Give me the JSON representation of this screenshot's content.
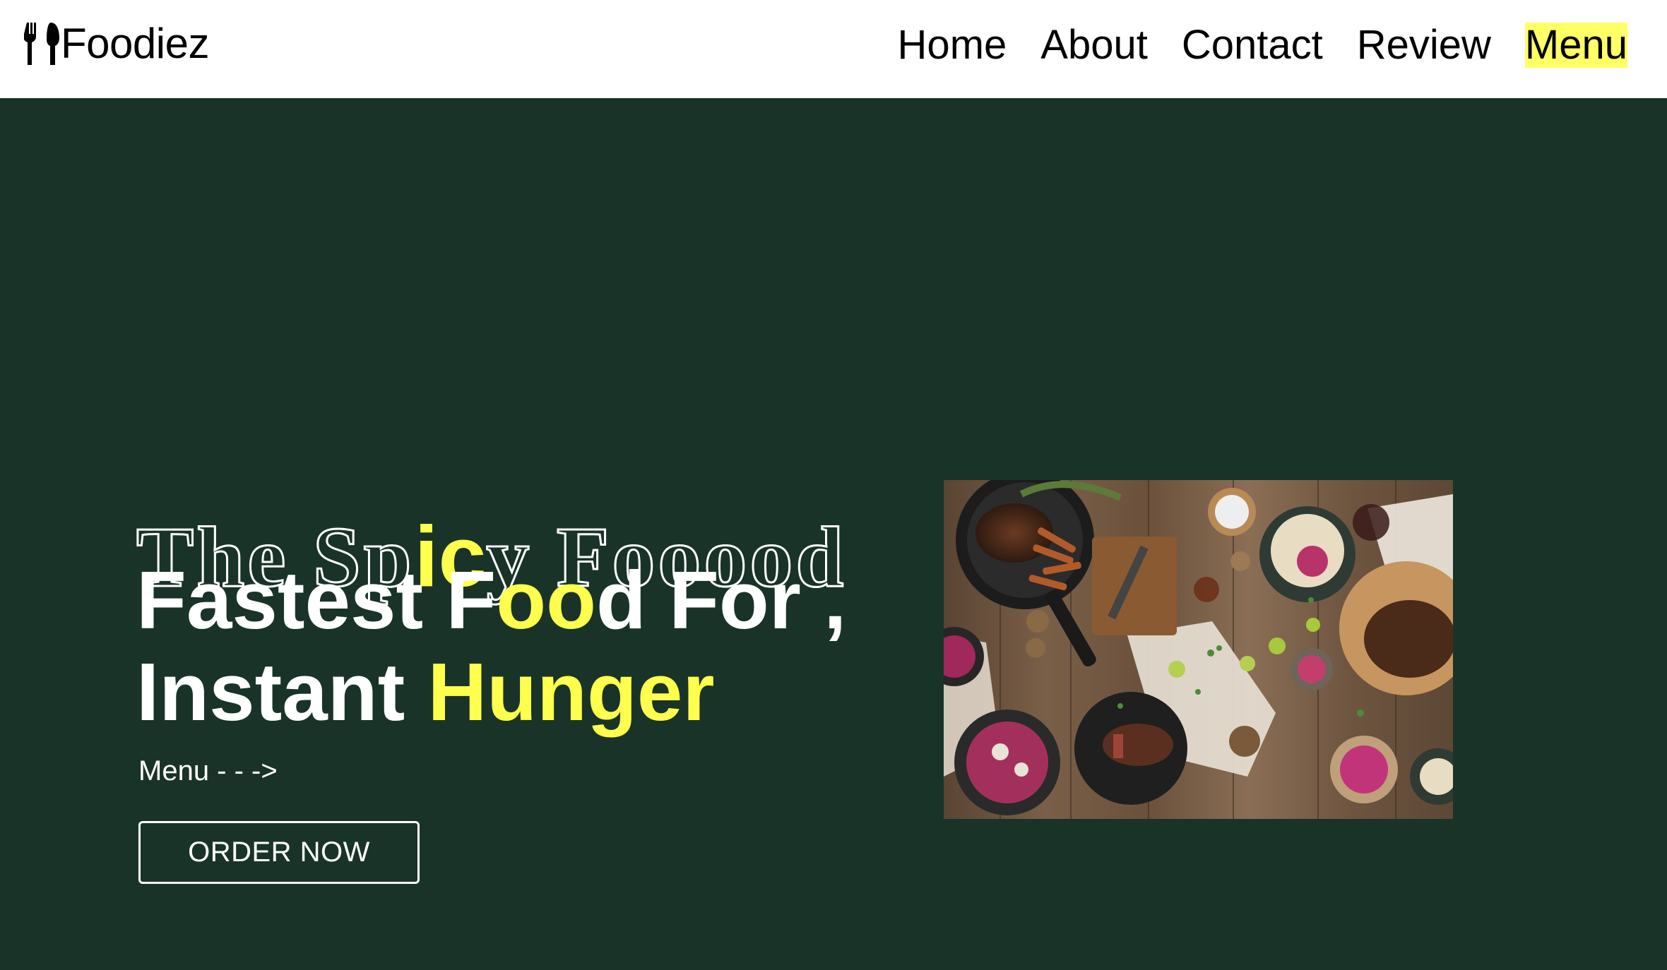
{
  "brand": {
    "name": "Foodiez",
    "icon": "fork-knife-icon"
  },
  "nav": {
    "items": [
      {
        "label": "Home",
        "active": false
      },
      {
        "label": "About",
        "active": false
      },
      {
        "label": "Contact",
        "active": false
      },
      {
        "label": "Review",
        "active": false
      },
      {
        "label": "Menu",
        "active": true
      }
    ]
  },
  "hero": {
    "title_parts": [
      "The Sp",
      "ic",
      "y Fooood"
    ],
    "headline_line1_parts": [
      "Fastest F",
      "oo",
      "d For ,"
    ],
    "headline_line2_parts": [
      "Instant ",
      "Hunger"
    ],
    "menu_link": "Menu - - ->",
    "order_button": "ORDER NOW"
  },
  "colors": {
    "background": "#1a3329",
    "accent": "#ffff4d",
    "nav_highlight": "#ffff66",
    "topbar": "#ffffff"
  }
}
